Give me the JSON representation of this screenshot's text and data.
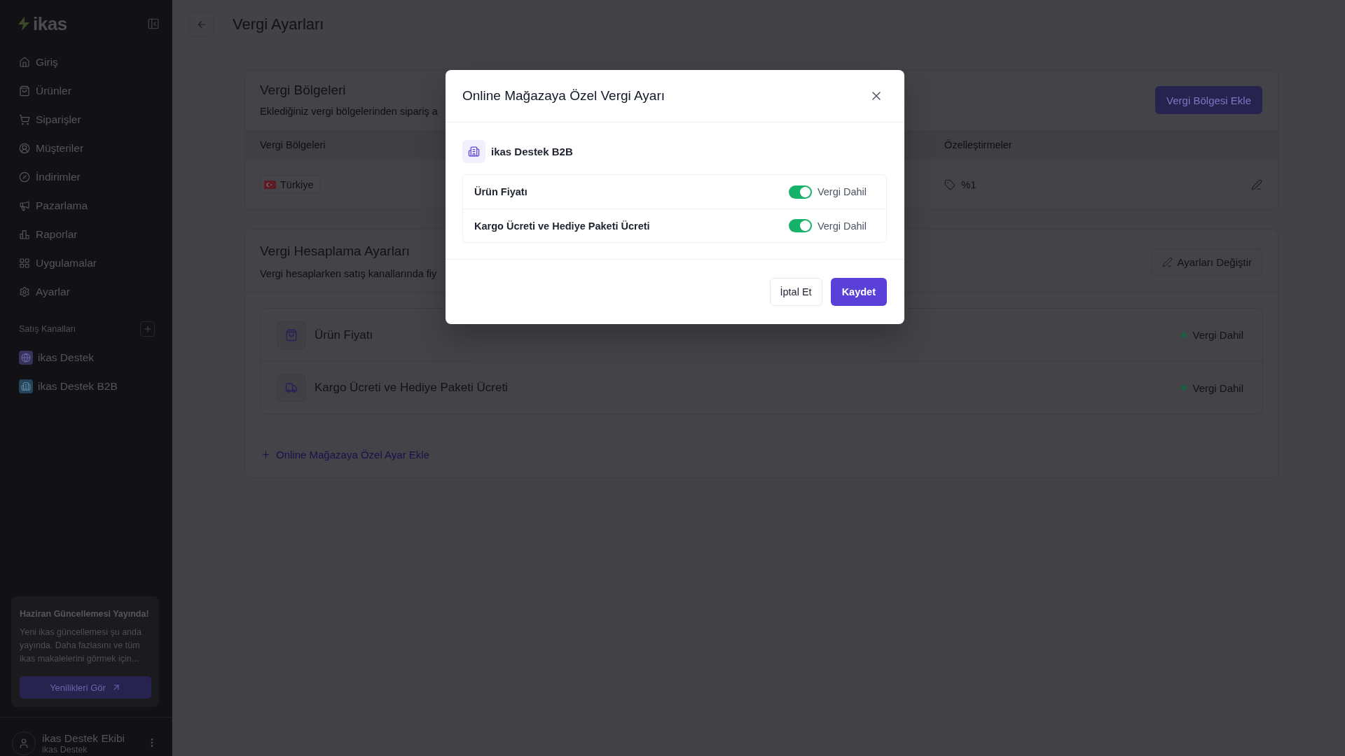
{
  "sidebar": {
    "logo": "ikas",
    "nav": [
      {
        "label": "Giriş",
        "selected": false
      },
      {
        "label": "Ürünler",
        "selected": false
      },
      {
        "label": "Siparişler",
        "selected": false
      },
      {
        "label": "Müşteriler",
        "selected": false
      },
      {
        "label": "İndirimler",
        "selected": false
      },
      {
        "label": "Pazarlama",
        "selected": false
      },
      {
        "label": "Raporlar",
        "selected": false
      },
      {
        "label": "Uygulamalar",
        "selected": false
      },
      {
        "label": "Ayarlar",
        "selected": false
      }
    ],
    "channels_title": "Satış Kanalları",
    "channels": [
      {
        "label": "ikas Destek"
      },
      {
        "label": "ikas Destek B2B"
      }
    ],
    "update_card": {
      "title": "Haziran Güncellemesi Yayında!",
      "text": "Yeni ikas güncellemesi şu anda yayında. Daha fazlasını ve tüm ikas makalelerini görmek için...",
      "button": "Yenilikleri Gör"
    },
    "user": {
      "name": "ikas Destek Ekibi",
      "store": "ikas Destek"
    }
  },
  "page": {
    "title": "Vergi Ayarları"
  },
  "tax_regions": {
    "title": "Vergi Bölgeleri",
    "description": "Eklediğiniz vergi bölgelerinden sipariş a",
    "add_button": "Vergi Bölgesi Ekle",
    "columns": [
      "Vergi Bölgeleri",
      "Özelleştirmeler"
    ],
    "rows": [
      {
        "region": "Türkiye",
        "customization": "%1"
      }
    ]
  },
  "tax_calculation": {
    "title": "Vergi Hesaplama Ayarları",
    "description": "Vergi hesaplarken satış kanallarında fiy",
    "change_button": "Ayarları Değiştir",
    "items": [
      {
        "label": "Ürün Fiyatı",
        "status": "Vergi Dahil"
      },
      {
        "label": "Kargo Ücreti ve Hediye Paketi Ücreti",
        "status": "Vergi Dahil"
      }
    ],
    "add_link": "Online Mağazaya Özel Ayar Ekle"
  },
  "modal": {
    "title": "Online Mağazaya Özel Vergi Ayarı",
    "channel": "ikas Destek B2B",
    "settings": [
      {
        "label": "Ürün Fiyatı",
        "on": true,
        "status": "Vergi Dahil"
      },
      {
        "label": "Kargo Ücreti ve Hediye Paketi Ücreti",
        "on": true,
        "status": "Vergi Dahil"
      }
    ],
    "cancel_button": "İptal Et",
    "save_button": "Kaydet"
  }
}
